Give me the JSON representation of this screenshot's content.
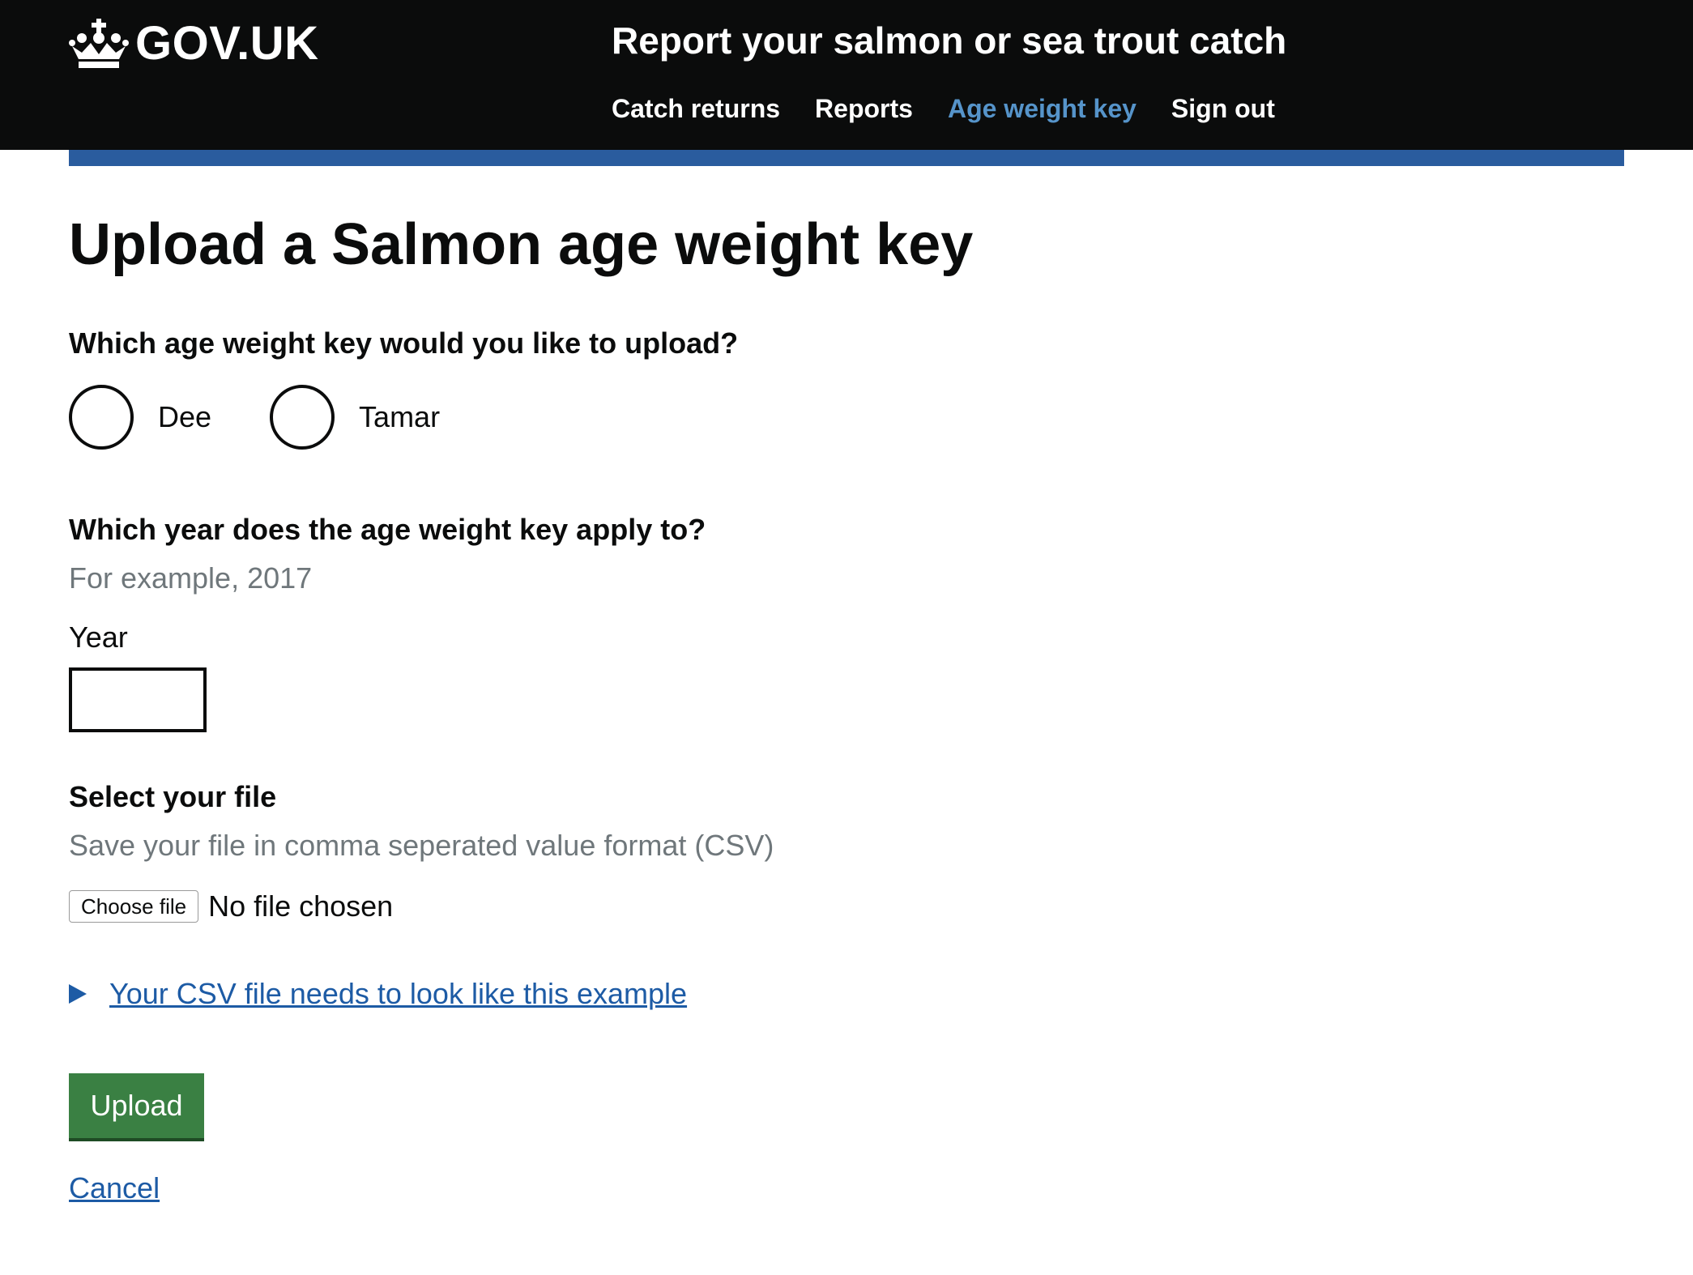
{
  "header": {
    "logo_text": "GOV.UK",
    "service_name": "Report your salmon or sea trout catch",
    "nav": [
      {
        "label": "Catch returns",
        "active": false
      },
      {
        "label": "Reports",
        "active": false
      },
      {
        "label": "Age weight key",
        "active": true
      },
      {
        "label": "Sign out",
        "active": false
      }
    ]
  },
  "page": {
    "title": "Upload a Salmon age weight key",
    "key_question": "Which age weight key would you like to upload?",
    "key_options": [
      "Dee",
      "Tamar"
    ],
    "year_question": "Which year does the age weight key apply to?",
    "year_hint": "For example, 2017",
    "year_label": "Year",
    "year_value": "",
    "file_question": "Select your file",
    "file_hint": "Save your file in comma seperated value format (CSV)",
    "file_button": "Choose file",
    "file_status": "No file chosen",
    "details_summary": "Your CSV file needs to look like this example",
    "upload_button": "Upload",
    "cancel_link": "Cancel"
  },
  "colors": {
    "header_bg": "#0b0c0c",
    "blue_bar": "#2a5c9e",
    "nav_active": "#5694ca",
    "link": "#1d5ba5",
    "button_green": "#3a8043",
    "hint_grey": "#6f777b"
  },
  "icons": {
    "logo": "crown-icon",
    "details": "triangle-right-icon"
  }
}
